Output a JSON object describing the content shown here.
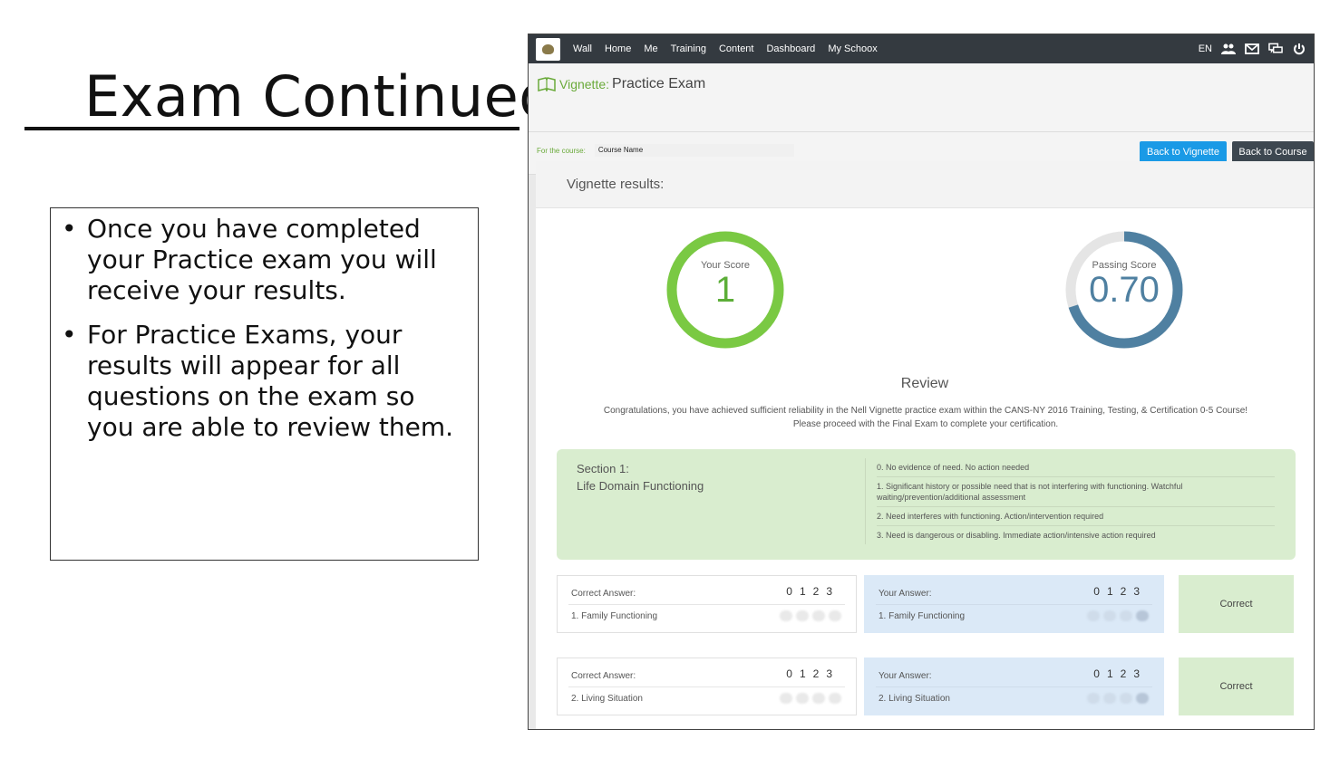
{
  "slide": {
    "title": "Exam Continued",
    "bullets": [
      "Once you have completed your Practice exam you will receive your results.",
      "For Practice Exams, your results will appear for all questions on the exam so you are able to review them."
    ]
  },
  "nav": {
    "items": [
      "Wall",
      "Home",
      "Me",
      "Training",
      "Content",
      "Dashboard",
      "My Schoox"
    ],
    "language": "EN",
    "icons": [
      "group-icon",
      "mail-icon",
      "chat-icon",
      "power-icon"
    ]
  },
  "page": {
    "heading_prefix": "Vignette:",
    "heading": "Practice Exam",
    "course_label": "For the course:",
    "course_value": "Course Name",
    "back_to_vignette": "Back to Vignette",
    "back_to_course": "Back to Course"
  },
  "results": {
    "header": "Vignette results:",
    "your_score_label": "Your Score",
    "your_score_value": "1",
    "your_score_fraction": 1.0,
    "passing_score_label": "Passing Score",
    "passing_score_value": "0.70",
    "passing_score_fraction": 0.7,
    "colors": {
      "your_score": "#7ac943",
      "passing": "#4f80a1",
      "track": "#e5e5e5"
    },
    "review_title": "Review",
    "review_line1": "Congratulations, you have achieved sufficient reliability in the Nell Vignette practice exam within the CANS-NY 2016 Training, Testing, & Certification 0-5 Course!",
    "review_line2": "Please proceed with the Final Exam to complete your certification."
  },
  "section": {
    "title_line1": "Section 1:",
    "title_line2": "Life Domain Functioning",
    "scale": [
      "0. No evidence of need. No action needed",
      "1. Significant history or possible need that is not interfering with functioning. Watchful waiting/prevention/additional assessment",
      "2. Need interferes with functioning. Action/intervention required",
      "3. Need is dangerous or disabling. Immediate action/intensive action required"
    ]
  },
  "answers": [
    {
      "correct_label": "Correct Answer:",
      "your_label": "Your Answer:",
      "scale": "0123",
      "item": "1. Family Functioning",
      "result": "Correct"
    },
    {
      "correct_label": "Correct Answer:",
      "your_label": "Your Answer:",
      "scale": "0123",
      "item": "2. Living Situation",
      "result": "Correct"
    }
  ]
}
